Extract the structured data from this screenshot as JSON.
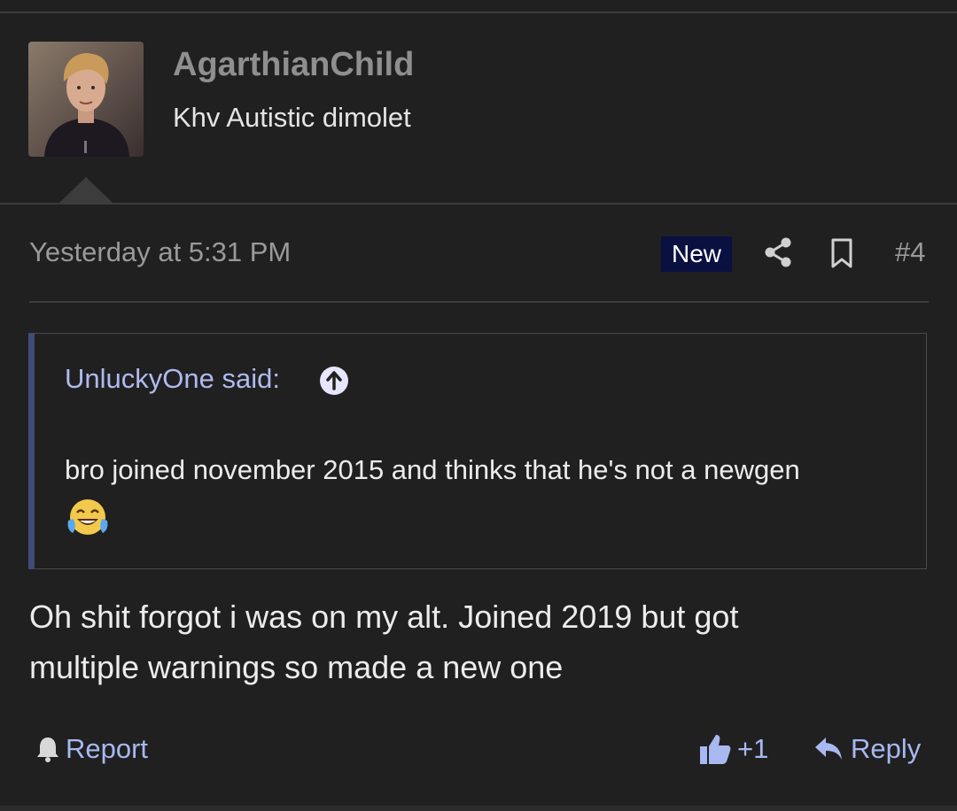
{
  "post": {
    "author": "AgarthianChild",
    "user_title": "Khv Autistic dimolet",
    "date": "Yesterday at 5:31 PM",
    "new_badge": "New",
    "post_number": "#4",
    "avatar_icon": "user-avatar-photo",
    "icons": {
      "share": "share-icon",
      "bookmark": "bookmark-icon"
    },
    "quote": {
      "author_label": "UnluckyOne said:",
      "text": "bro joined november 2015 and thinks that he's not a newgen",
      "emoji": "tears-of-joy-emoji"
    },
    "body_lines": [
      "Oh shit forgot i was on my alt. Joined 2019 but got",
      "multiple warnings so made a new one"
    ],
    "actions": {
      "report": "Report",
      "like_count": "+1",
      "reply": "Reply"
    },
    "colors": {
      "background": "#202020",
      "link": "#a8b8f0",
      "new_badge_bg": "#0a1040",
      "quote_accent": "#3e4d7a"
    }
  }
}
